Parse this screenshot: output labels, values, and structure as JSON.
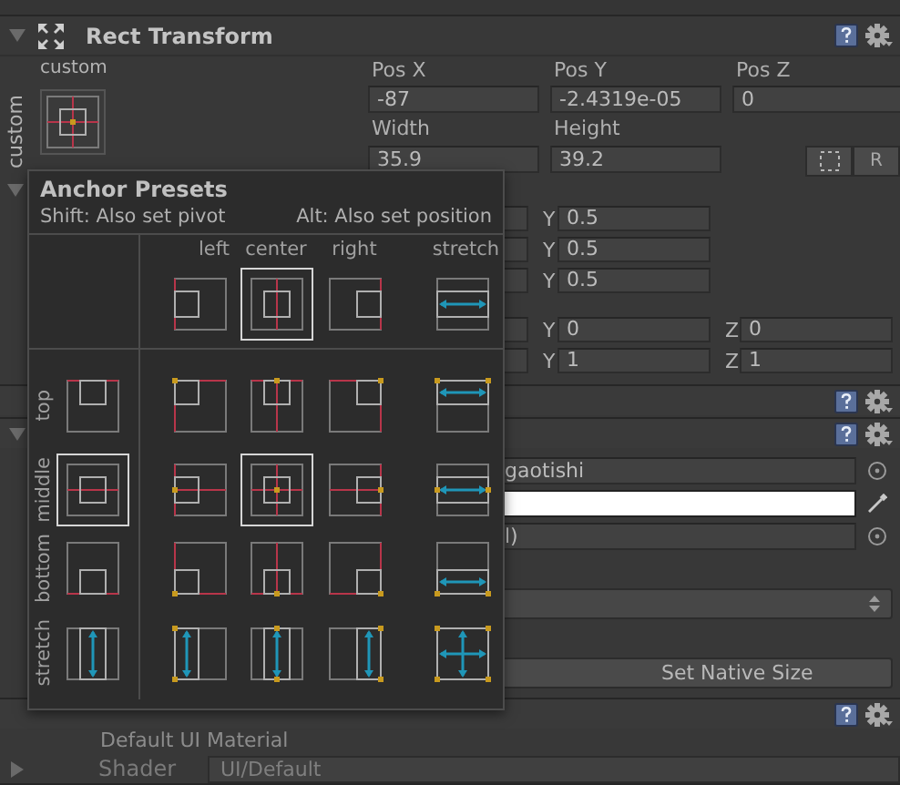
{
  "rect_transform": {
    "title": "Rect Transform",
    "expanded": true,
    "anchor_label": "custom",
    "anchor_side_label": "custom",
    "fields": [
      {
        "label": "Pos X",
        "value": "-87"
      },
      {
        "label": "Pos Y",
        "value": "-2.4319e-05"
      },
      {
        "label": "Pos Z",
        "value": "0"
      },
      {
        "label": "Width",
        "value": "35.9"
      },
      {
        "label": "Height",
        "value": "39.2"
      }
    ],
    "raw_button": "R",
    "vector_rows": [
      {
        "fields": [
          {
            "axis": "Y",
            "value": "0.5"
          }
        ]
      },
      {
        "fields": [
          {
            "axis": "Y",
            "value": "0.5"
          }
        ]
      },
      {
        "fields": [
          {
            "axis": "Y",
            "value": "0.5"
          }
        ]
      },
      {
        "fields": [
          {
            "axis": "Y",
            "value": "0"
          },
          {
            "axis": "Z",
            "value": "0"
          }
        ]
      },
      {
        "fields": [
          {
            "axis": "Y",
            "value": "1"
          },
          {
            "axis": "Z",
            "value": "1"
          }
        ]
      }
    ]
  },
  "image": {
    "sprite": "gaotishi",
    "material": "l)",
    "button": "Set Native Size"
  },
  "material": {
    "name": "Default UI Material",
    "expanded": false,
    "shader_label": "Shader",
    "shader": "UI/Default"
  },
  "anchor_presets": {
    "title": "Anchor Presets",
    "shift_hint": "Shift: Also set pivot",
    "alt_hint": "Alt: Also set position",
    "columns": [
      {
        "label": "left",
        "selected": false
      },
      {
        "label": "center",
        "selected": true
      },
      {
        "label": "right",
        "selected": false
      },
      {
        "label": "stretch",
        "selected": false
      }
    ],
    "rows": [
      {
        "label": "top",
        "selected": false,
        "cells": [
          {
            "selected": false
          },
          {
            "selected": false
          },
          {
            "selected": false
          },
          {
            "selected": false
          }
        ]
      },
      {
        "label": "middle",
        "selected": true,
        "cells": [
          {
            "selected": false
          },
          {
            "selected": true
          },
          {
            "selected": false
          },
          {
            "selected": false
          }
        ]
      },
      {
        "label": "bottom",
        "selected": false,
        "cells": [
          {
            "selected": false
          },
          {
            "selected": false
          },
          {
            "selected": false
          },
          {
            "selected": false
          }
        ]
      },
      {
        "label": "stretch",
        "selected": false,
        "cells": [
          {
            "selected": false
          },
          {
            "selected": false
          },
          {
            "selected": false
          },
          {
            "selected": false
          }
        ]
      }
    ]
  }
}
